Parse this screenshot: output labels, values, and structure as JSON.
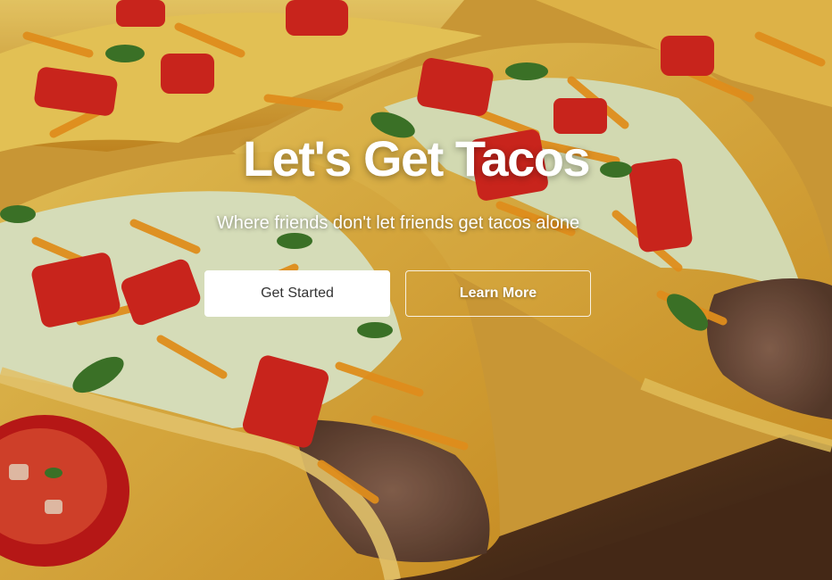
{
  "hero": {
    "title": "Let's Get Tacos",
    "subtitle": "Where friends don't let friends get tacos alone",
    "primary_button": "Get Started",
    "secondary_button": "Learn More"
  },
  "background": {
    "subject": "tacos-photo",
    "colors": {
      "shell": "#e8b53a",
      "tomato": "#d9281f",
      "cheese": "#f29a1f",
      "lettuce": "#dce7b0",
      "wood": "#5a3520"
    }
  }
}
